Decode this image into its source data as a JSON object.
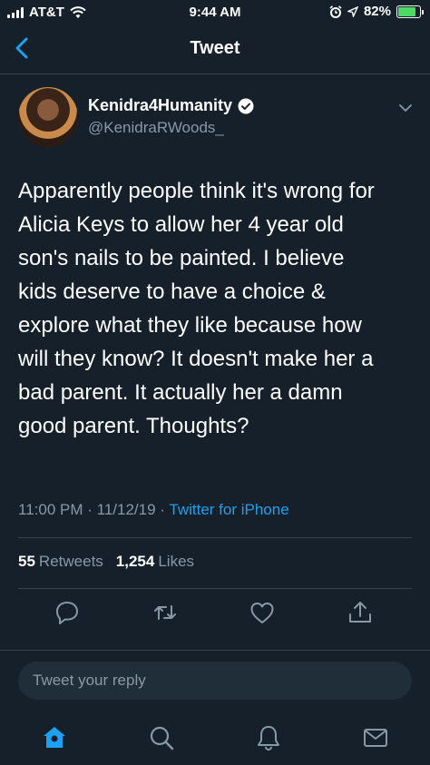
{
  "status_bar": {
    "carrier": "AT&T",
    "time": "9:44 AM",
    "battery": "82%",
    "battery_level": 0.82
  },
  "nav": {
    "title": "Tweet"
  },
  "tweet": {
    "display_name": "Kenidra4Humanity",
    "handle": "@KenidraRWoods_",
    "text": "Apparently people think it's wrong for\nAlicia Keys to allow her 4 year old\nson's nails to be painted. I believe\nkids deserve to have a choice &\nexplore what they like because how\nwill they know? It doesn't make her a\nbad parent. It actually her a damn\ngood parent. Thoughts?",
    "time": "11:00 PM",
    "date": "11/12/19",
    "source": "Twitter for iPhone",
    "retweets_count": "55",
    "retweets_label": "Retweets",
    "likes_count": "1,254",
    "likes_label": "Likes"
  },
  "reply": {
    "placeholder": "Tweet your reply"
  },
  "colors": {
    "background": "#15202b",
    "accent": "#1da1f2",
    "secondary_text": "#8899a6",
    "border": "#38444d"
  },
  "icons": {
    "back": "chevron-left-icon",
    "verified": "verified-badge-icon",
    "caret": "chevron-down-icon",
    "reply": "comment-icon",
    "retweet": "retweet-icon",
    "like": "heart-icon",
    "share": "share-icon",
    "home": "home-icon",
    "search": "search-icon",
    "notifications": "bell-icon",
    "messages": "mail-icon"
  }
}
